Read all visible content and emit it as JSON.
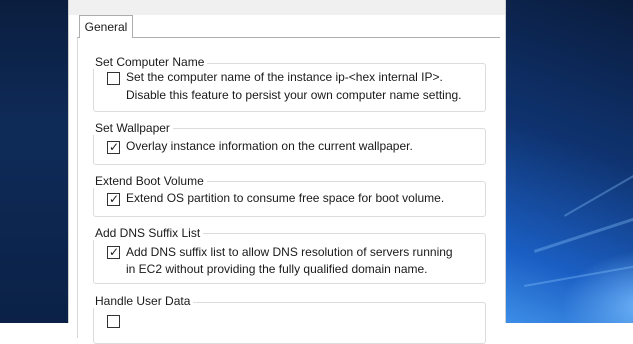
{
  "tabs": [
    {
      "label": "General",
      "selected": true
    }
  ],
  "groups": [
    {
      "title": "Set Computer Name",
      "checked": false,
      "lines": [
        "Set the computer name of the instance ip-<hex internal IP>.",
        "Disable this feature to persist your own computer name setting."
      ]
    },
    {
      "title": "Set Wallpaper",
      "checked": true,
      "lines": [
        "Overlay instance information on the current wallpaper."
      ]
    },
    {
      "title": "Extend Boot Volume",
      "checked": true,
      "lines": [
        "Extend OS partition to consume free space for boot volume."
      ]
    },
    {
      "title": "Add DNS Suffix List",
      "checked": true,
      "lines": [
        "Add DNS suffix list to allow DNS resolution of servers running",
        "in EC2 without providing the fully qualified domain name."
      ]
    },
    {
      "title": "Handle User Data",
      "checked": false,
      "lines": []
    }
  ]
}
